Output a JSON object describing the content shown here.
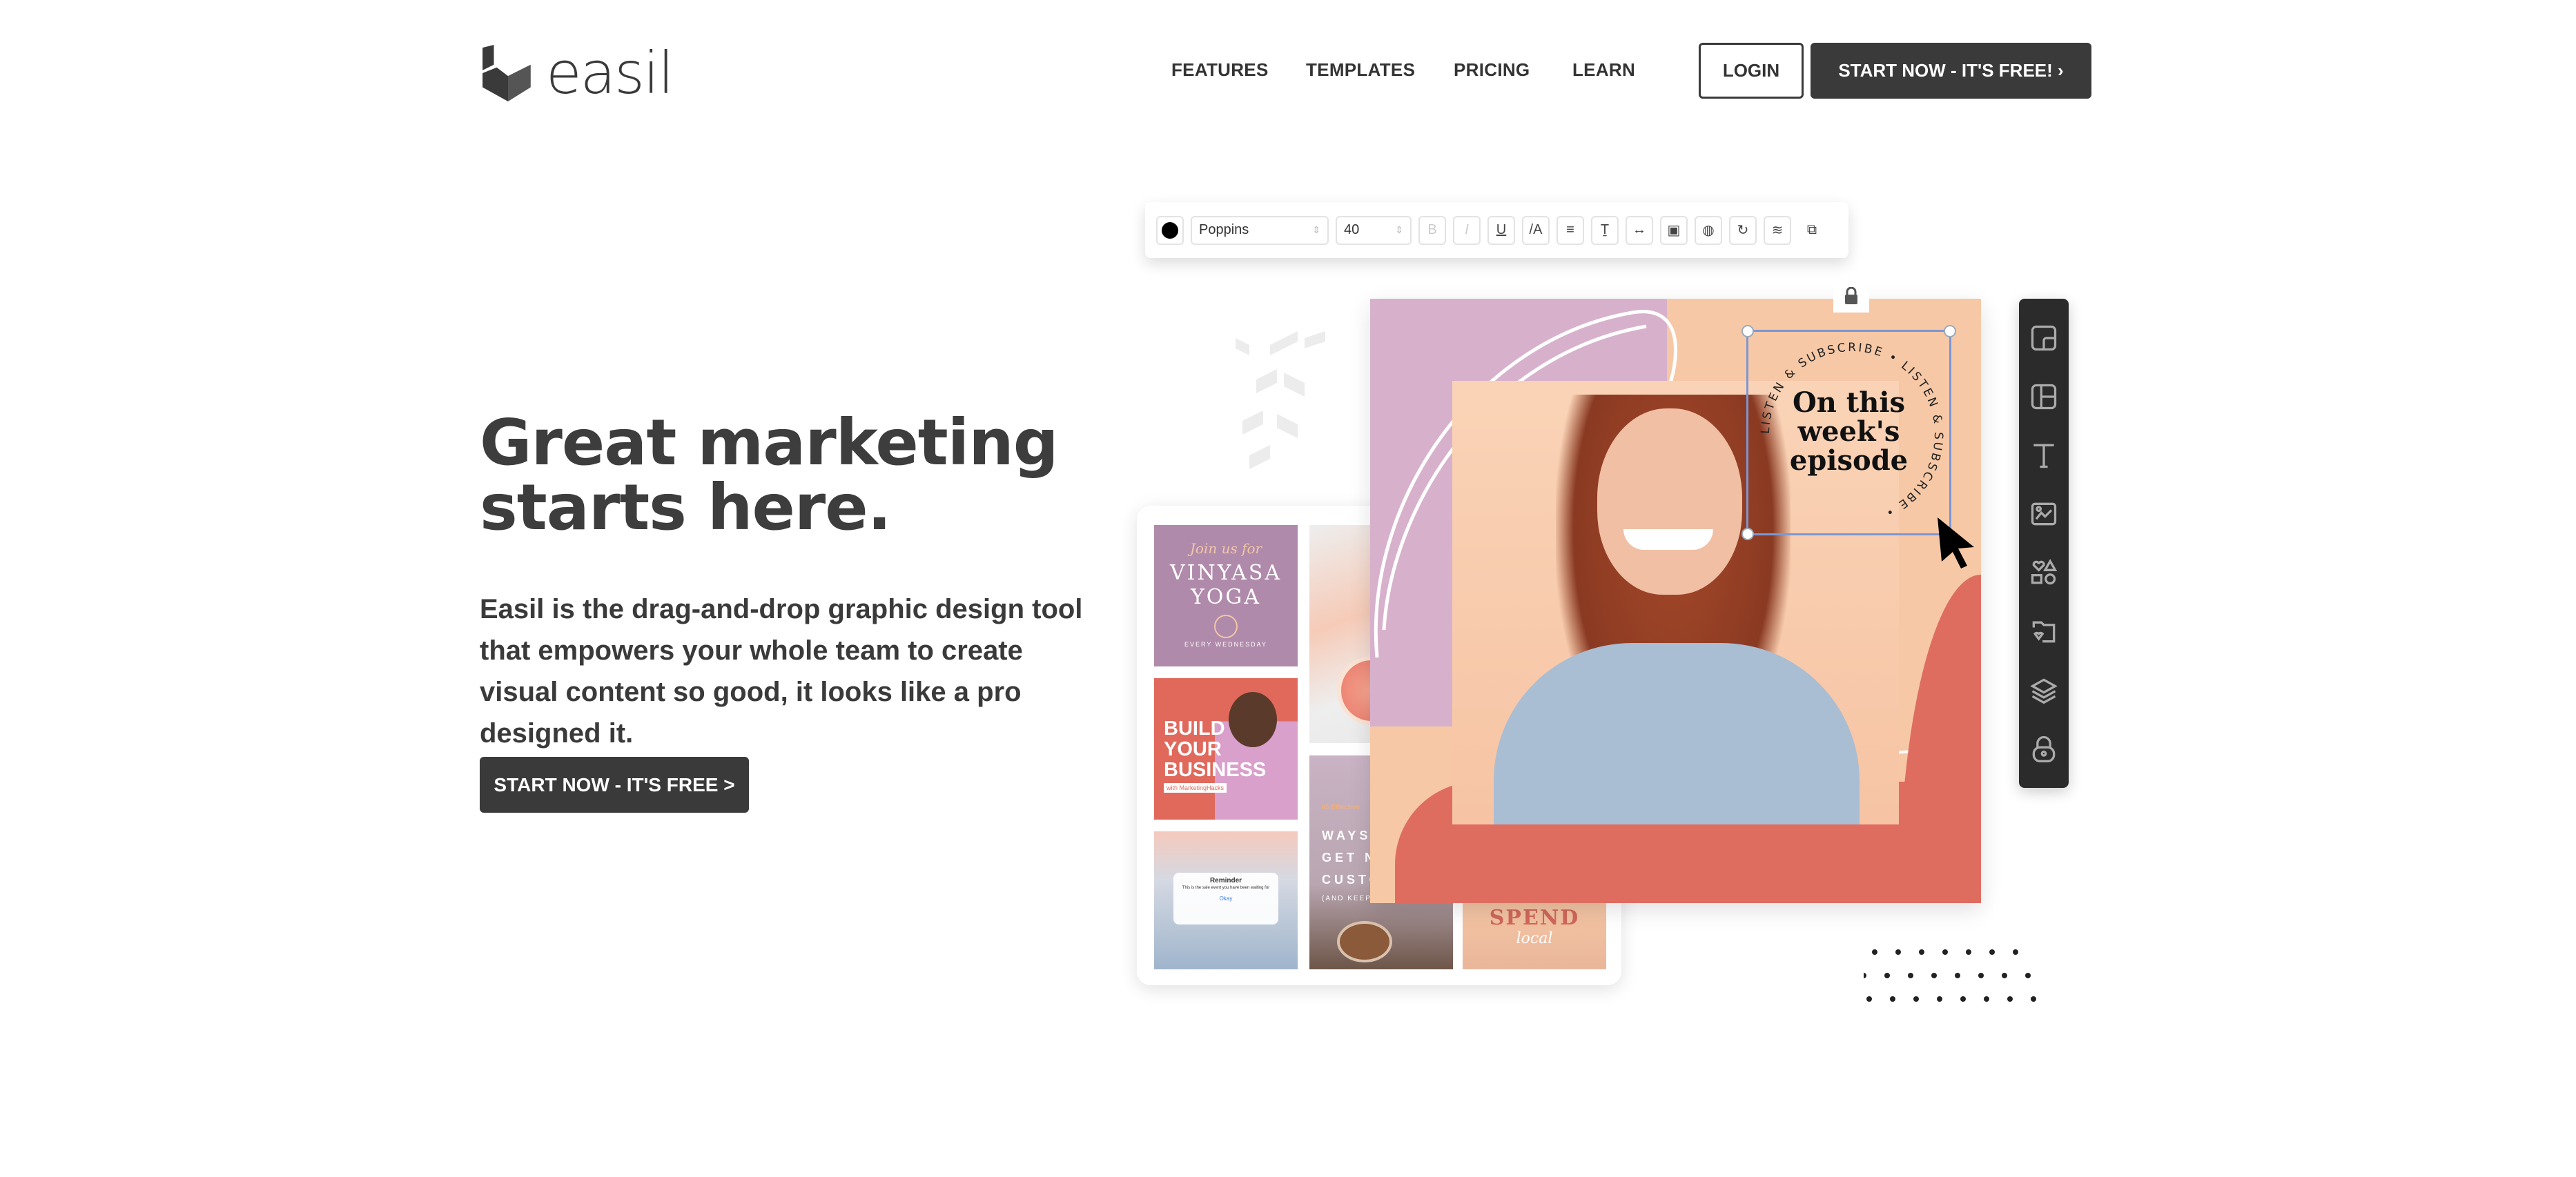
{
  "header": {
    "brand": "easil",
    "nav": [
      "FEATURES",
      "TEMPLATES",
      "PRICING",
      "LEARN"
    ],
    "login": "LOGIN",
    "start": "START NOW - IT'S FREE! ›"
  },
  "hero": {
    "headline_1": "Great marketing",
    "headline_2": "starts here.",
    "lead": "Easil is the drag-and-drop graphic design tool that empowers your whole team to create visual content so good, it looks like a pro designed it.",
    "cta": "START NOW - IT'S FREE >"
  },
  "editor_toolbar": {
    "font": "Poppins",
    "size": "40",
    "color": "#000000",
    "buttons": [
      "bold-icon",
      "italic-icon",
      "underline-icon",
      "text-style-icon",
      "align-center-icon",
      "line-height-icon",
      "letter-spacing-icon",
      "frame-icon",
      "opacity-icon",
      "rotate-icon",
      "layers-icon",
      "duplicate-icon"
    ]
  },
  "templates": {
    "yoga_small": "Join us for",
    "yoga_title_1": "VINYASA",
    "yoga_title_2": "YOGA",
    "yoga_sub": "EVERY WEDNESDAY",
    "biz_1": "BUILD",
    "biz_2": "YOUR",
    "biz_3": "BUSINESS",
    "biz_tag": "with MarketingHacks",
    "reminder_title": "Reminder",
    "reminder_body": "This is the sale event you have been waiting for",
    "reminder_ok": "Okay",
    "ways_tag": "IG Effective",
    "ways_1": "WAYS T",
    "ways_2": "GET NE",
    "ways_3": "CUSTO",
    "ways_4": "(AND KEEP",
    "spend_1": "SPEND",
    "spend_2": "local"
  },
  "canvas": {
    "circle_text": "LISTEN & SUBSCRIBE • LISTEN & SUBSCRIBE • ",
    "title_1": "On this",
    "title_2": "week's",
    "title_3": "episode",
    "bg": "#f6c8a6",
    "coral": "#de6d60",
    "lilac": "#d7b1cc"
  },
  "sidebar": {
    "icons": [
      "templates-icon",
      "layouts-icon",
      "text-icon",
      "image-icon",
      "shapes-icon",
      "my-files-icon",
      "layers-icon",
      "lock-icon"
    ]
  }
}
